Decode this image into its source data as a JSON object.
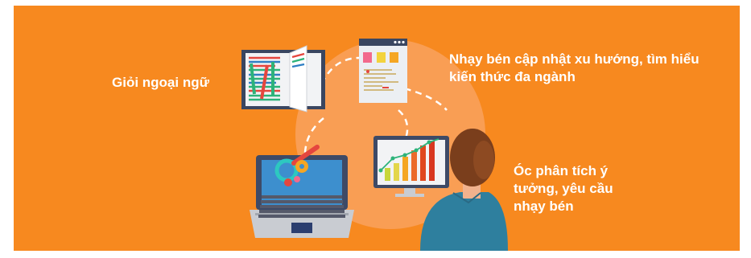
{
  "colors": {
    "background": "#F7891F",
    "circle": "#F9A25E",
    "text": "#FFFFFF",
    "book_cover": "#3A4660",
    "page_green": "#2DB37A",
    "page_red": "#E5463E",
    "page_blue": "#2F7FC4",
    "chart_bar_light": "#C8D63A",
    "chart_bar_dark": "#D8371F",
    "person_hair": "#7A3E1C",
    "person_skin": "#F1B28D",
    "person_shirt": "#2E7F9E",
    "laptop_frame": "#3E4A66",
    "laptop_screen": "#3D8FCE"
  },
  "icons": [
    "book-icon",
    "document-icon",
    "laptop-gears-icon",
    "chart-monitor-icon",
    "person-icon"
  ],
  "skills": {
    "languages": "Giỏi ngoại ngữ",
    "trends_line1": "Nhạy bén cập nhật xu hướng, tìm hiểu",
    "trends_line2": "kiến thức đa ngành",
    "analysis_line1": "Óc phân tích ý",
    "analysis_line2": "tưởng, yêu cầu",
    "analysis_line3": "nhạy bén"
  }
}
